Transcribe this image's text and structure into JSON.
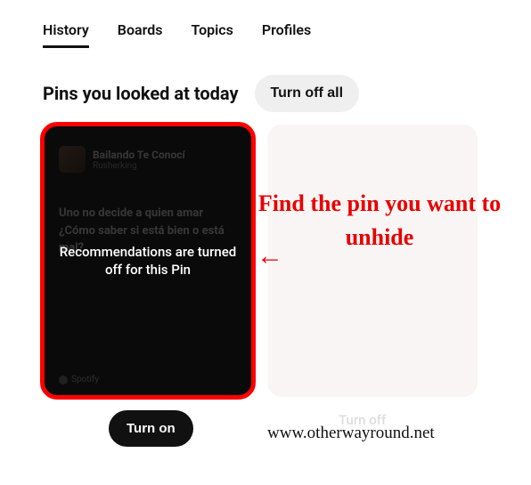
{
  "tabs": {
    "history": "History",
    "boards": "Boards",
    "topics": "Topics",
    "profiles": "Profiles"
  },
  "section": {
    "title": "Pins you looked at today",
    "turn_off_all": "Turn off all"
  },
  "pin1": {
    "track_title": "Bailando Te Conocí",
    "track_artist": "Rusherking",
    "quote_line1": "Uno no decide a quien amar",
    "quote_line2": "¿Cómo saber si está bien o está mal?",
    "spotify_label": "Spotify",
    "overlay": "Recommendations are turned off for this Pin"
  },
  "turn_on": "Turn on",
  "annotation": "Find the pin you want to unhide",
  "arrow": "←",
  "watermark": "www.otherwayround.net",
  "faded_turn_off": "Turn off"
}
